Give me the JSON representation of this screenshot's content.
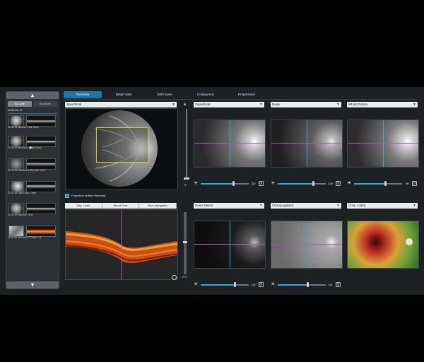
{
  "left_panel": {
    "up_arrow": "▲",
    "down_arrow": "▼",
    "sort_tabs": [
      "By Date",
      "By Mode"
    ],
    "date_header": "2020-01-17",
    "scans": [
      {
        "label": "11:05:18 Macular Multi Scan"
      },
      {
        "label": "11:04:49 Macular Lines(12mm)"
      },
      {
        "label": "11:03:35 Glaucoma Macular Cube"
      },
      {
        "label": "11:02:36 Optic Disc Cube"
      },
      {
        "label": "11:01:23 Macular Cube"
      },
      {
        "label": "11:00:49 Macular OCTA(3 x 3)"
      }
    ]
  },
  "tabs": [
    {
      "label": "Overview",
      "active": true
    },
    {
      "label": "Detail View"
    },
    {
      "label": "Both Eyes"
    },
    {
      "label": "Comparison"
    },
    {
      "label": "Progression"
    }
  ],
  "fundus": {
    "dropdown": "Superficial",
    "slider_top_value": "0",
    "slider_bottom_value": "271"
  },
  "projection_artifact_label": "Projection Artifact Removal",
  "bscan_buttons": [
    "Seg. Lines",
    "Blood Flow",
    "Slice Navigation"
  ],
  "angio": [
    {
      "name": "Superficial",
      "value": "110"
    },
    {
      "name": "Deep",
      "value": "108"
    },
    {
      "name": "Whole Retina",
      "value": "96"
    },
    {
      "name": "Outer Retina",
      "value": "132"
    },
    {
      "name": "Choriocapillaris",
      "value": "116"
    },
    {
      "name": "Color coded",
      "value": ""
    }
  ],
  "icons": {
    "brightness": "☀",
    "reset": "⟳",
    "dropdown_caret": "▼",
    "contrast": "◐"
  },
  "colors": {
    "accent": "#1d78a8",
    "background": "#1c2124"
  }
}
